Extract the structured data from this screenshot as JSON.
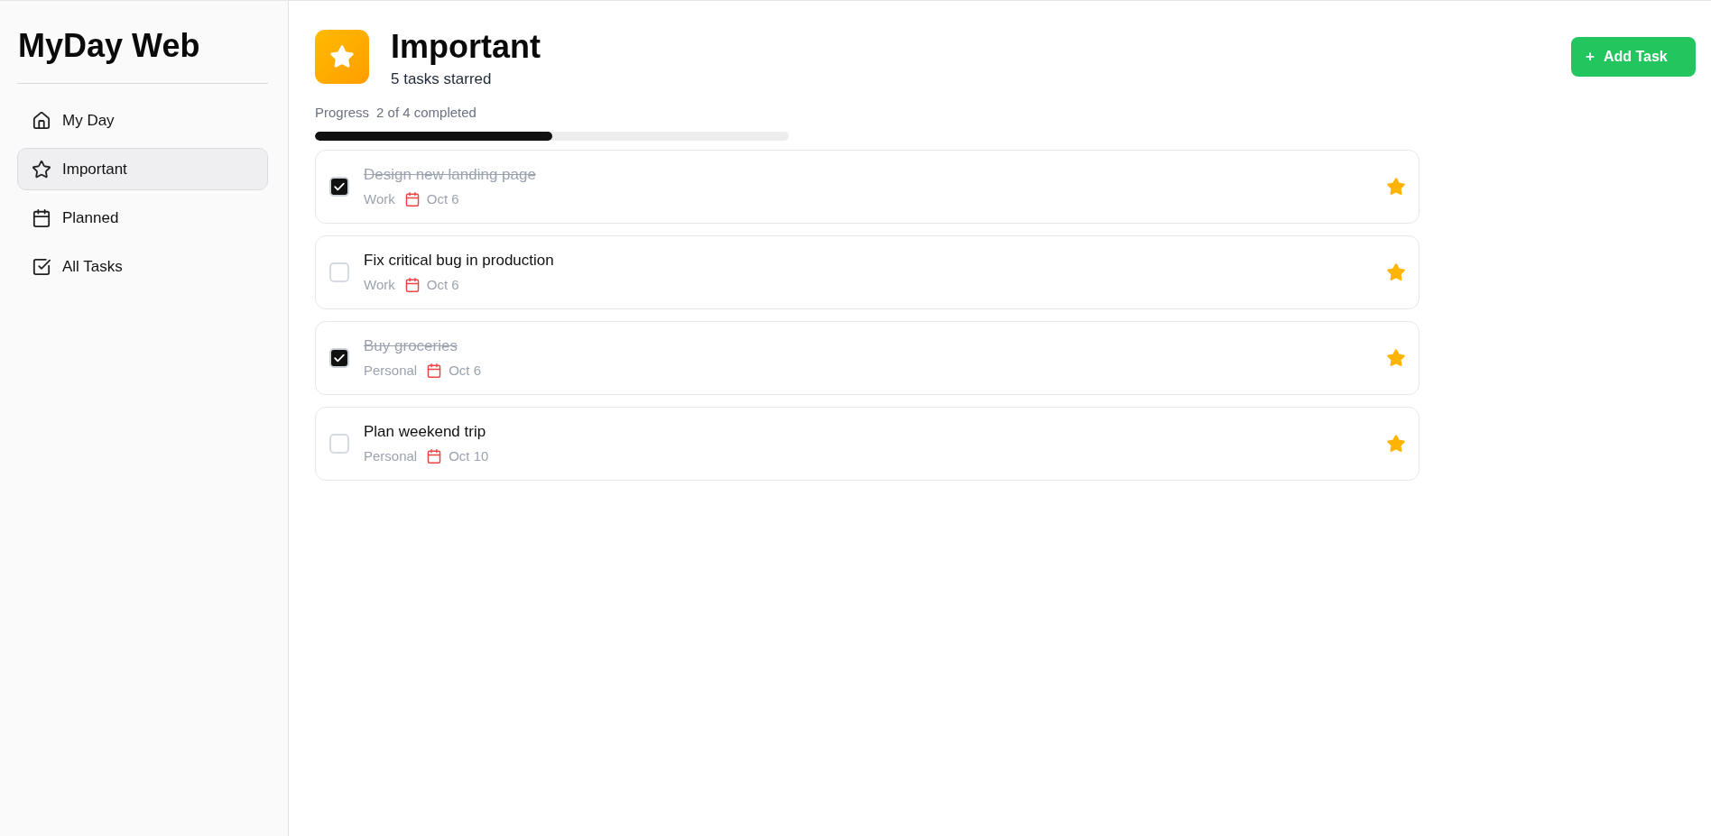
{
  "sidebar": {
    "title": "MyDay Web",
    "items": [
      {
        "label": "My Day",
        "selected": false
      },
      {
        "label": "Important",
        "selected": true
      },
      {
        "label": "Planned",
        "selected": false
      },
      {
        "label": "All Tasks",
        "selected": false
      }
    ]
  },
  "header": {
    "title": "Important",
    "subtitle": "5 tasks starred"
  },
  "add_button": {
    "icon": "+",
    "label": "Add Task"
  },
  "progress": {
    "label": "Progress",
    "reading": "2 of 4 completed",
    "level": 0.5
  },
  "tasks": [
    {
      "title": "Design new landing page",
      "completed": true,
      "starred": true,
      "category": "Work",
      "date": "Oct 6"
    },
    {
      "title": "Fix critical bug in production",
      "completed": false,
      "starred": true,
      "category": "Work",
      "date": "Oct 6"
    },
    {
      "title": "Buy groceries",
      "completed": true,
      "starred": true,
      "category": "Personal",
      "date": "Oct 6"
    },
    {
      "title": "Plan weekend trip",
      "completed": false,
      "starred": true,
      "category": "Personal",
      "date": "Oct 10"
    }
  ]
}
